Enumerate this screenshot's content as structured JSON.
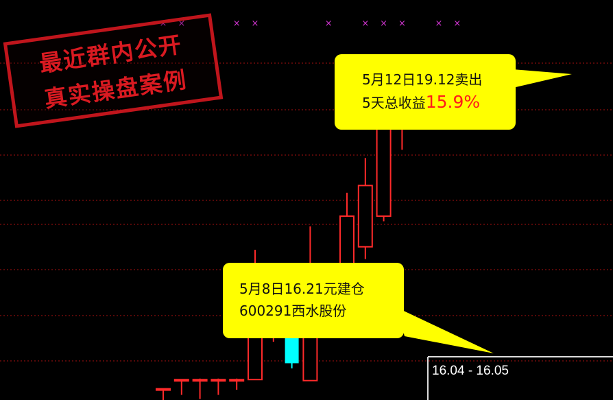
{
  "stamp": {
    "line1": "最近群内公开",
    "line2": "真实操盘案例",
    "color": "#d91a21"
  },
  "sell_note": {
    "line1": "5月12日19.12卖出",
    "line2_prefix": "5天总收益",
    "line2_value": "15.9%"
  },
  "buy_note": {
    "line1": "5月8日16.21元建仓",
    "line2": "600291西水股份"
  },
  "price_range_label": "16.04 - 16.05",
  "colors": {
    "up": "#ff2a2a",
    "down": "#00ffff",
    "grid": "#aa1111",
    "marker": "#cc33cc",
    "bubble": "#ffff00"
  },
  "chart_data": {
    "type": "candlestick",
    "ylim": [
      15.85,
      19.35
    ],
    "candles": [
      {
        "o": 15.96,
        "c": 15.96,
        "h": 15.96,
        "l": 15.85,
        "dir": "up"
      },
      {
        "o": 16.05,
        "c": 16.05,
        "h": 16.05,
        "l": 15.9,
        "dir": "up"
      },
      {
        "o": 16.05,
        "c": 16.05,
        "h": 16.06,
        "l": 15.86,
        "dir": "up"
      },
      {
        "o": 16.05,
        "c": 16.05,
        "h": 16.06,
        "l": 15.9,
        "dir": "up"
      },
      {
        "o": 16.05,
        "c": 16.05,
        "h": 16.06,
        "l": 15.95,
        "dir": "up"
      },
      {
        "o": 16.05,
        "c": 16.97,
        "h": 17.32,
        "l": 16.05,
        "dir": "up"
      },
      {
        "o": 16.76,
        "c": 16.94,
        "h": 16.97,
        "l": 16.42,
        "dir": "up"
      },
      {
        "o": 16.8,
        "c": 16.21,
        "h": 16.8,
        "l": 16.16,
        "dir": "down"
      },
      {
        "o": 16.04,
        "c": 17.05,
        "h": 17.55,
        "l": 16.04,
        "dir": "up"
      },
      {
        "o": 17.05,
        "c": 16.98,
        "h": 17.05,
        "l": 16.6,
        "dir": "down"
      },
      {
        "o": 16.9,
        "c": 17.65,
        "h": 17.88,
        "l": 16.9,
        "dir": "up"
      },
      {
        "o": 17.35,
        "c": 17.95,
        "h": 18.22,
        "l": 17.23,
        "dir": "up"
      },
      {
        "o": 17.65,
        "c": 18.77,
        "h": 19.12,
        "l": 17.6,
        "dir": "up"
      },
      {
        "o": 18.77,
        "c": 18.8,
        "h": 19.12,
        "l": 18.3,
        "dir": "up"
      },
      {
        "o": 18.77,
        "c": 18.77,
        "h": 18.85,
        "l": 18.5,
        "dir": "down"
      }
    ],
    "signal_markers": [
      0,
      1,
      4,
      5,
      9,
      11,
      12,
      13,
      15,
      16
    ]
  }
}
